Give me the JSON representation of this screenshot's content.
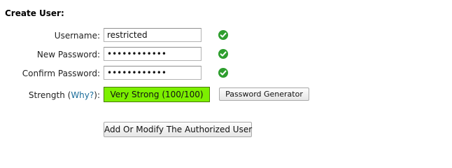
{
  "form": {
    "title": "Create User:",
    "username": {
      "label": "Username:",
      "value": "restricted"
    },
    "new_password": {
      "label": "New Password:",
      "value": "••••••••••••"
    },
    "confirm_password": {
      "label": "Confirm Password:",
      "value": "••••••••••••"
    },
    "strength": {
      "label_prefix": "Strength (",
      "why_link": "Why?",
      "label_suffix": "):",
      "value": "Very Strong (100/100)",
      "color": "#7cf000"
    },
    "generator_button": "Password Generator",
    "submit_button": "Add Or Modify The Authorized User",
    "valid_icon_color": "#2e9e2e"
  }
}
